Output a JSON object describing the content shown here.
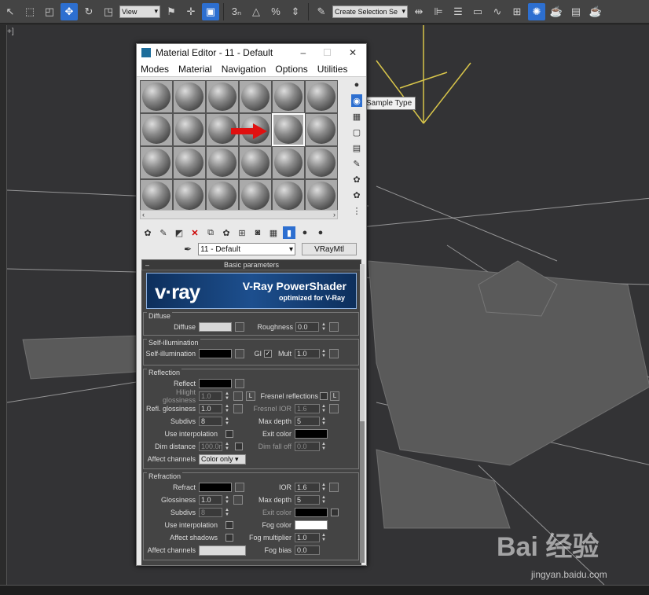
{
  "main_toolbar": {
    "view_dropdown": "View",
    "selection_set_placeholder": "Create Selection Se",
    "snap_labels": [
      "3",
      "%"
    ]
  },
  "viewport": {
    "label": "+]"
  },
  "tooltip": "Sample Type",
  "material_editor": {
    "title": "Material Editor - 11 - Default",
    "window_controls": [
      "–",
      "☐",
      "✕"
    ],
    "menu": [
      "Modes",
      "Material",
      "Navigation",
      "Options",
      "Utilities"
    ],
    "material_name": "11 - Default",
    "material_type": "VRayMtl",
    "basic_parameters_label": "Basic parameters",
    "banner": {
      "logo": "v·ray",
      "title": "V-Ray PowerShader",
      "subtitle": "optimized for V-Ray"
    },
    "diffuse": {
      "group": "Diffuse",
      "diffuse_label": "Diffuse",
      "diffuse_color": "#d8d8d8",
      "roughness_label": "Roughness",
      "roughness_value": "0.0"
    },
    "self_illum": {
      "group": "Self-illumination",
      "label": "Self-illumination",
      "color": "#000000",
      "gi_label": "GI",
      "gi_checked": "✓",
      "mult_label": "Mult",
      "mult_value": "1.0"
    },
    "reflection": {
      "group": "Reflection",
      "reflect_label": "Reflect",
      "reflect_color": "#000000",
      "hilight_label": "Hilight glossiness",
      "hilight_value": "1.0",
      "lock_label": "L",
      "fresnel_label": "Fresnel reflections",
      "fresnel_lock": "L",
      "refl_gloss_label": "Refl. glossiness",
      "refl_gloss_value": "1.0",
      "fresnel_ior_label": "Fresnel IOR",
      "fresnel_ior_value": "1.6",
      "subdivs_label": "Subdivs",
      "subdivs_value": "8",
      "max_depth_label": "Max depth",
      "max_depth_value": "5",
      "use_interp_label": "Use interpolation",
      "exit_color_label": "Exit color",
      "exit_color": "#000000",
      "dim_distance_label": "Dim distance",
      "dim_distance_value": "100.0m",
      "dim_falloff_label": "Dim fall off",
      "dim_falloff_value": "0.0",
      "affect_channels_label": "Affect channels",
      "affect_channels_value": "Color only"
    },
    "refraction": {
      "group": "Refraction",
      "refract_label": "Refract",
      "refract_color": "#000000",
      "ior_label": "IOR",
      "ior_value": "1.6",
      "glossiness_label": "Glossiness",
      "glossiness_value": "1.0",
      "max_depth_label": "Max depth",
      "max_depth_value": "5",
      "subdivs_label": "Subdivs",
      "subdivs_value": "8",
      "exit_color_label": "Exit color",
      "exit_color": "#000000",
      "use_interp_label": "Use interpolation",
      "fog_color_label": "Fog color",
      "fog_color": "#ffffff",
      "affect_shadows_label": "Affect shadows",
      "fog_mult_label": "Fog multiplier",
      "fog_mult_value": "1.0",
      "affect_channels_label": "Affect channels",
      "fog_bias_label": "Fog bias",
      "fog_bias_value": "0.0"
    }
  },
  "watermark": {
    "brand": "Bai 经验",
    "url": "jingyan.baidu.com"
  }
}
